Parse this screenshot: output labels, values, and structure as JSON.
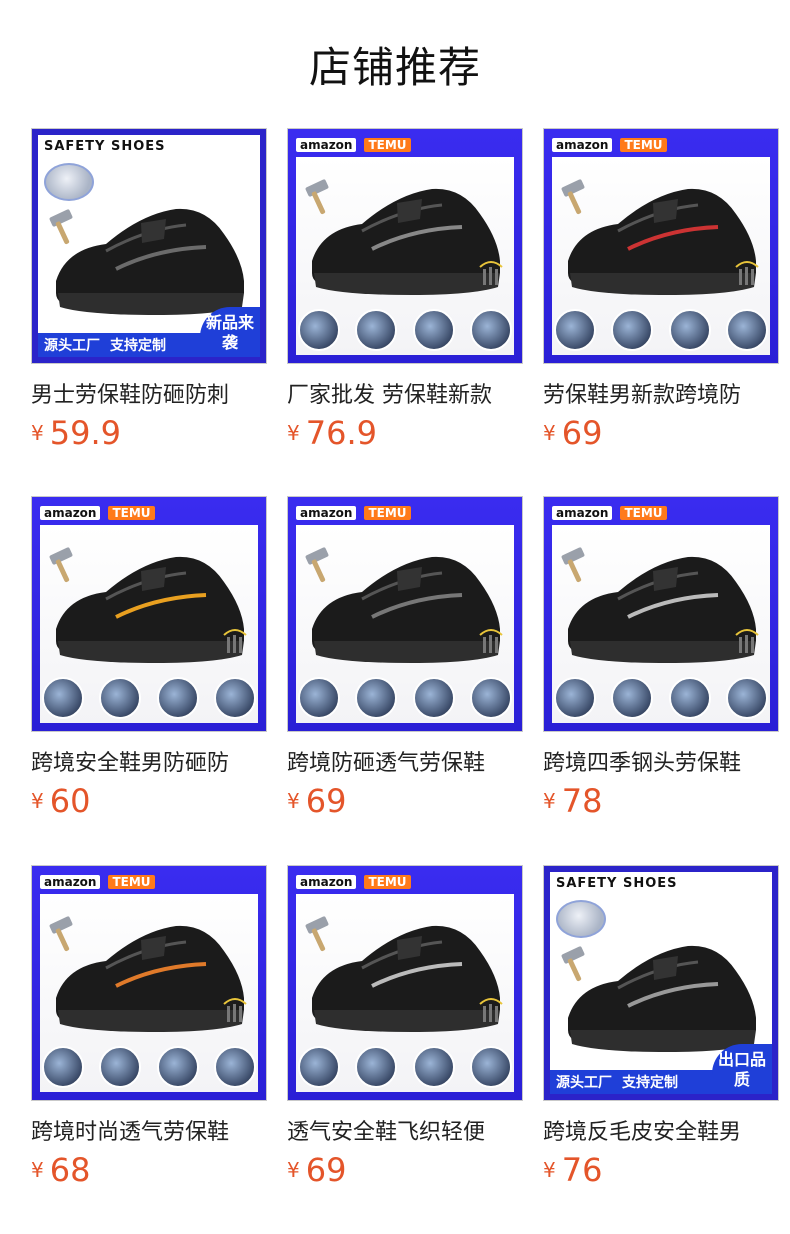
{
  "header": {
    "title": "店铺推荐"
  },
  "common": {
    "currency": "¥",
    "brand_amazon": "amazon",
    "brand_temu": "TEMU",
    "safety_text": "SAFETY SHOES",
    "factory_text": "源头工厂",
    "custom_text": "支持定制"
  },
  "products": [
    {
      "title": "男士劳保鞋防砸防刺",
      "price": "59.9",
      "variant": "safety",
      "corner": "新品来袭"
    },
    {
      "title": "厂家批发 劳保鞋新款",
      "price": "76.9",
      "variant": "brand"
    },
    {
      "title": "劳保鞋男新款跨境防",
      "price": "69",
      "variant": "brand"
    },
    {
      "title": "跨境安全鞋男防砸防",
      "price": "60",
      "variant": "brand"
    },
    {
      "title": "跨境防砸透气劳保鞋",
      "price": "69",
      "variant": "brand"
    },
    {
      "title": "跨境四季钢头劳保鞋",
      "price": "78",
      "variant": "brand"
    },
    {
      "title": "跨境时尚透气劳保鞋",
      "price": "68",
      "variant": "brand"
    },
    {
      "title": "透气安全鞋飞织轻便",
      "price": "69",
      "variant": "brand"
    },
    {
      "title": "跨境反毛皮安全鞋男",
      "price": "76",
      "variant": "safety",
      "corner": "出口品质"
    }
  ]
}
